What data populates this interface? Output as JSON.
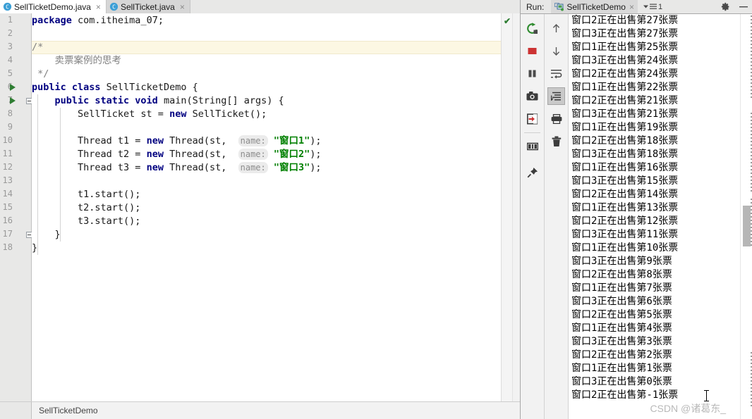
{
  "window": {
    "ide": "IntelliJ IDEA",
    "watermark": "CSDN @诸葛东_"
  },
  "editor": {
    "tabs": [
      {
        "label": "SellTicketDemo.java",
        "icon": "java-class-icon",
        "active": true,
        "close": "×"
      },
      {
        "label": "SellTicket.java",
        "icon": "java-class-icon",
        "active": false,
        "close": "×"
      }
    ],
    "inspection_status": "✔",
    "caret_line_number": 3,
    "lines": [
      {
        "n": 1,
        "indent": 0,
        "runnable": false,
        "fold": false,
        "tokens": [
          {
            "t": "kw",
            "v": "package"
          },
          {
            "t": "plain",
            "v": " com.itheima_07;"
          }
        ]
      },
      {
        "n": 2,
        "indent": 0,
        "runnable": false,
        "fold": false,
        "tokens": []
      },
      {
        "n": 3,
        "indent": 0,
        "runnable": false,
        "fold": false,
        "tokens": [
          {
            "t": "cmt",
            "v": "/*"
          }
        ]
      },
      {
        "n": 4,
        "indent": 0,
        "runnable": false,
        "fold": false,
        "tokens": [
          {
            "t": "cmt",
            "v": "    卖票案例的思考"
          }
        ]
      },
      {
        "n": 5,
        "indent": 0,
        "runnable": false,
        "fold": false,
        "tokens": [
          {
            "t": "cmt",
            "v": " */"
          }
        ]
      },
      {
        "n": 6,
        "indent": 0,
        "runnable": true,
        "fold": false,
        "tokens": [
          {
            "t": "kw",
            "v": "public class"
          },
          {
            "t": "plain",
            "v": " SellTicketDemo {"
          }
        ]
      },
      {
        "n": 7,
        "indent": 1,
        "runnable": true,
        "fold": true,
        "tokens": [
          {
            "t": "plain",
            "v": "    "
          },
          {
            "t": "kw",
            "v": "public static void"
          },
          {
            "t": "plain",
            "v": " main(String[] args) {"
          }
        ]
      },
      {
        "n": 8,
        "indent": 2,
        "runnable": false,
        "fold": false,
        "tokens": [
          {
            "t": "plain",
            "v": "        SellTicket st = "
          },
          {
            "t": "kw",
            "v": "new"
          },
          {
            "t": "plain",
            "v": " SellTicket();"
          }
        ]
      },
      {
        "n": 9,
        "indent": 2,
        "runnable": false,
        "fold": false,
        "tokens": []
      },
      {
        "n": 10,
        "indent": 2,
        "runnable": false,
        "fold": false,
        "tokens": [
          {
            "t": "plain",
            "v": "        Thread t1 = "
          },
          {
            "t": "kw",
            "v": "new"
          },
          {
            "t": "plain",
            "v": " Thread(st,  "
          },
          {
            "t": "hint",
            "v": "name:"
          },
          {
            "t": "plain",
            "v": " "
          },
          {
            "t": "str",
            "v": "\"窗口1\""
          },
          {
            "t": "plain",
            "v": ");"
          }
        ]
      },
      {
        "n": 11,
        "indent": 2,
        "runnable": false,
        "fold": false,
        "tokens": [
          {
            "t": "plain",
            "v": "        Thread t2 = "
          },
          {
            "t": "kw",
            "v": "new"
          },
          {
            "t": "plain",
            "v": " Thread(st,  "
          },
          {
            "t": "hint",
            "v": "name:"
          },
          {
            "t": "plain",
            "v": " "
          },
          {
            "t": "str",
            "v": "\"窗口2\""
          },
          {
            "t": "plain",
            "v": ");"
          }
        ]
      },
      {
        "n": 12,
        "indent": 2,
        "runnable": false,
        "fold": false,
        "tokens": [
          {
            "t": "plain",
            "v": "        Thread t3 = "
          },
          {
            "t": "kw",
            "v": "new"
          },
          {
            "t": "plain",
            "v": " Thread(st,  "
          },
          {
            "t": "hint",
            "v": "name:"
          },
          {
            "t": "plain",
            "v": " "
          },
          {
            "t": "str",
            "v": "\"窗口3\""
          },
          {
            "t": "plain",
            "v": ");"
          }
        ]
      },
      {
        "n": 13,
        "indent": 2,
        "runnable": false,
        "fold": false,
        "tokens": []
      },
      {
        "n": 14,
        "indent": 2,
        "runnable": false,
        "fold": false,
        "tokens": [
          {
            "t": "plain",
            "v": "        t1.start();"
          }
        ]
      },
      {
        "n": 15,
        "indent": 2,
        "runnable": false,
        "fold": false,
        "tokens": [
          {
            "t": "plain",
            "v": "        t2.start();"
          }
        ]
      },
      {
        "n": 16,
        "indent": 2,
        "runnable": false,
        "fold": false,
        "tokens": [
          {
            "t": "plain",
            "v": "        t3.start();"
          }
        ]
      },
      {
        "n": 17,
        "indent": 1,
        "runnable": false,
        "fold": true,
        "tokens": [
          {
            "t": "plain",
            "v": "    }"
          }
        ]
      },
      {
        "n": 18,
        "indent": 0,
        "runnable": false,
        "fold": false,
        "tokens": [
          {
            "t": "plain",
            "v": "}"
          }
        ]
      }
    ]
  },
  "status_bar": {
    "text": "SellTicketDemo"
  },
  "run_window": {
    "title": "Run:",
    "configuration": "SellTicketDemo",
    "configuration_icon": "run-config-icon",
    "close_label": "×",
    "filter_label": "1",
    "header_icons": [
      {
        "name": "settings-gear-icon"
      },
      {
        "name": "minimize-icon"
      }
    ],
    "toolbar_primary": [
      {
        "name": "rerun-icon",
        "tooltip": "Rerun",
        "selected": false
      },
      {
        "name": "stop-icon",
        "tooltip": "Stop",
        "selected": false
      },
      {
        "name": "pause-icon",
        "tooltip": "Pause Output",
        "selected": false
      },
      {
        "name": "camera-icon",
        "tooltip": "Dump Threads",
        "selected": false
      },
      {
        "name": "exit-icon",
        "tooltip": "Exit",
        "selected": false
      },
      {
        "name": "layout-icon",
        "tooltip": "Layout Settings",
        "selected": false
      },
      {
        "name": "pin-icon",
        "tooltip": "Pin Tab",
        "selected": false
      }
    ],
    "toolbar_secondary": [
      {
        "name": "arrow-up-icon",
        "tooltip": "Up the Stack Trace",
        "selected": false
      },
      {
        "name": "arrow-down-icon",
        "tooltip": "Down the Stack Trace",
        "selected": false
      },
      {
        "name": "soft-wrap-icon",
        "tooltip": "Use Soft Wraps",
        "selected": false
      },
      {
        "name": "scroll-to-end-icon",
        "tooltip": "Scroll to End",
        "selected": true
      },
      {
        "name": "print-icon",
        "tooltip": "Print",
        "selected": false
      },
      {
        "name": "trash-icon",
        "tooltip": "Clear All",
        "selected": false
      }
    ],
    "console_lines": [
      "窗口2正在出售第27张票",
      "窗口3正在出售第27张票",
      "窗口1正在出售第25张票",
      "窗口3正在出售第24张票",
      "窗口2正在出售第24张票",
      "窗口1正在出售第22张票",
      "窗口2正在出售第21张票",
      "窗口3正在出售第21张票",
      "窗口1正在出售第19张票",
      "窗口2正在出售第18张票",
      "窗口3正在出售第18张票",
      "窗口1正在出售第16张票",
      "窗口3正在出售第15张票",
      "窗口2正在出售第14张票",
      "窗口1正在出售第13张票",
      "窗口2正在出售第12张票",
      "窗口3正在出售第11张票",
      "窗口1正在出售第10张票",
      "窗口3正在出售第9张票",
      "窗口2正在出售第8张票",
      "窗口1正在出售第7张票",
      "窗口3正在出售第6张票",
      "窗口2正在出售第5张票",
      "窗口1正在出售第4张票",
      "窗口3正在出售第3张票",
      "窗口2正在出售第2张票",
      "窗口1正在出售第1张票",
      "窗口3正在出售第0张票",
      "窗口2正在出售第-1张票"
    ]
  },
  "colors": {
    "keyword": "#000080",
    "string": "#008000",
    "comment": "#808080",
    "caret_line": "#fcf7e3",
    "run_green": "#2e7d32",
    "stop_red": "#cc3333",
    "tab_active_bg": "#ffffff",
    "panel_bg": "#f2f2f2"
  }
}
